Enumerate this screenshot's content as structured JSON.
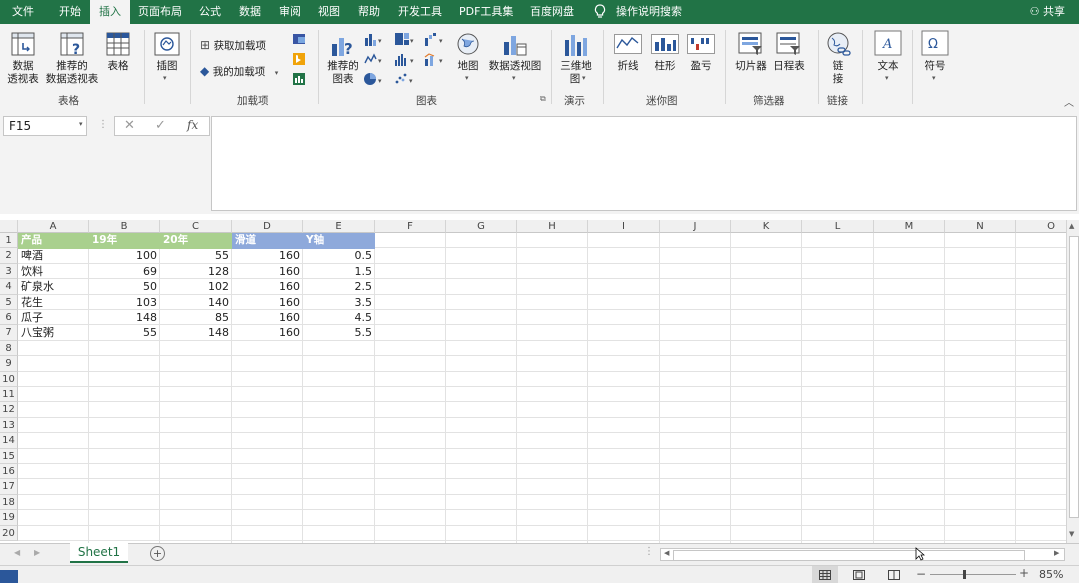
{
  "tabs": [
    "文件",
    "开始",
    "插入",
    "页面布局",
    "公式",
    "数据",
    "审阅",
    "视图",
    "帮助",
    "开发工具",
    "PDF工具集",
    "百度网盘"
  ],
  "active_tab": "插入",
  "search_label": "操作说明搜索",
  "share_label": "共享",
  "ribbon": {
    "pivot_label1": "数据",
    "pivot_label2": "透视表",
    "rec_pivot_label1": "推荐的",
    "rec_pivot_label2": "数据透视表",
    "table_label": "表格",
    "group_table": "表格",
    "illustrations_label": "插图",
    "get_addins": "获取加载项",
    "my_addins": "我的加载项",
    "group_addins": "加载项",
    "rec_chart_label1": "推荐的",
    "rec_chart_label2": "图表",
    "map_label": "地图",
    "pivot_chart_label": "数据透视图",
    "group_charts": "图表",
    "map3d_label1": "三维地",
    "map3d_label2": "图",
    "group_tours": "演示",
    "line_label": "折线",
    "column_label": "柱形",
    "winloss_label": "盈亏",
    "group_sparklines": "迷你图",
    "slicer_label": "切片器",
    "timeline_label": "日程表",
    "group_filters": "筛选器",
    "link_label1": "链",
    "link_label2": "接",
    "group_links": "链接",
    "text_label": "文本",
    "symbol_label": "符号"
  },
  "namebox": "F15",
  "columns": [
    "A",
    "B",
    "C",
    "D",
    "E",
    "F",
    "G",
    "H",
    "I",
    "J",
    "K",
    "L",
    "M",
    "N",
    "O"
  ],
  "rows": [
    "1",
    "2",
    "3",
    "4",
    "5",
    "6",
    "7",
    "8",
    "9",
    "10",
    "11",
    "12",
    "13",
    "14",
    "15",
    "16",
    "17",
    "18",
    "19",
    "20"
  ],
  "table": {
    "headers": [
      "产品",
      "19年",
      "20年",
      "滑道",
      "Y轴"
    ],
    "rows": [
      [
        "啤酒",
        "100",
        "55",
        "160",
        "0.5"
      ],
      [
        "饮料",
        "69",
        "128",
        "160",
        "1.5"
      ],
      [
        "矿泉水",
        "50",
        "102",
        "160",
        "2.5"
      ],
      [
        "花生",
        "103",
        "140",
        "160",
        "3.5"
      ],
      [
        "瓜子",
        "148",
        "85",
        "160",
        "4.5"
      ],
      [
        "八宝粥",
        "55",
        "148",
        "160",
        "5.5"
      ]
    ]
  },
  "colors": {
    "header_green": "#a9d08e",
    "header_blue": "#8ea9db",
    "brand": "#217346"
  },
  "sheet_tab": "Sheet1",
  "zoom": "85%"
}
